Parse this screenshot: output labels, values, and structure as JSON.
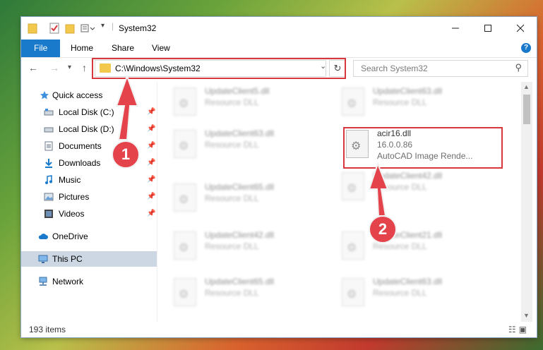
{
  "window": {
    "title": "System32"
  },
  "ribbon": {
    "tabs": [
      "File",
      "Home",
      "Share",
      "View"
    ],
    "help": "?"
  },
  "address": {
    "path": "C:\\Windows\\System32"
  },
  "search": {
    "placeholder": "Search System32"
  },
  "sidebar": {
    "items": [
      {
        "label": "Quick access",
        "icon": "star-icon"
      },
      {
        "label": "Local Disk (C:)",
        "icon": "drive-icon",
        "pinned": true
      },
      {
        "label": "Local Disk (D:)",
        "icon": "drive-icon",
        "pinned": true
      },
      {
        "label": "Documents",
        "icon": "documents-icon",
        "pinned": true
      },
      {
        "label": "Downloads",
        "icon": "download-icon",
        "pinned": true
      },
      {
        "label": "Music",
        "icon": "music-icon",
        "pinned": true
      },
      {
        "label": "Pictures",
        "icon": "pictures-icon",
        "pinned": true
      },
      {
        "label": "Videos",
        "icon": "videos-icon",
        "pinned": true
      },
      {
        "label": "OneDrive",
        "icon": "cloud-icon"
      },
      {
        "label": "This PC",
        "icon": "computer-icon",
        "selected": true
      },
      {
        "label": "Network",
        "icon": "network-icon"
      }
    ]
  },
  "files": [
    {
      "name": "UpdateClient5.dll",
      "type": "Resource DLL"
    },
    {
      "name": "UpdateClient63.dll",
      "type": "Resource DLL"
    },
    {
      "name": "UpdateClient63.dll",
      "type": "Resource DLL"
    },
    {
      "name": "acir16.dll",
      "version": "16.0.0.86",
      "description": "AutoCAD Image Rende..."
    },
    {
      "name": "UpdateClient65.dll",
      "type": "Resource DLL"
    },
    {
      "name": "UpdateClient42.dll",
      "type": "Resource DLL"
    },
    {
      "name": "UpdateClient42.dll",
      "type": "Resource DLL"
    },
    {
      "name": "UpdateClient21.dll",
      "type": "Resource DLL"
    },
    {
      "name": "UpdateClient65.dll",
      "type": "Resource DLL"
    },
    {
      "name": "UpdateClient63.dll",
      "type": "Resource DLL"
    }
  ],
  "status": {
    "count": "193 items"
  },
  "annotations": {
    "marker1": "1",
    "marker2": "2"
  },
  "colors": {
    "accent": "#1979ca",
    "highlight": "#d9363e",
    "marker": "#e4434b"
  }
}
